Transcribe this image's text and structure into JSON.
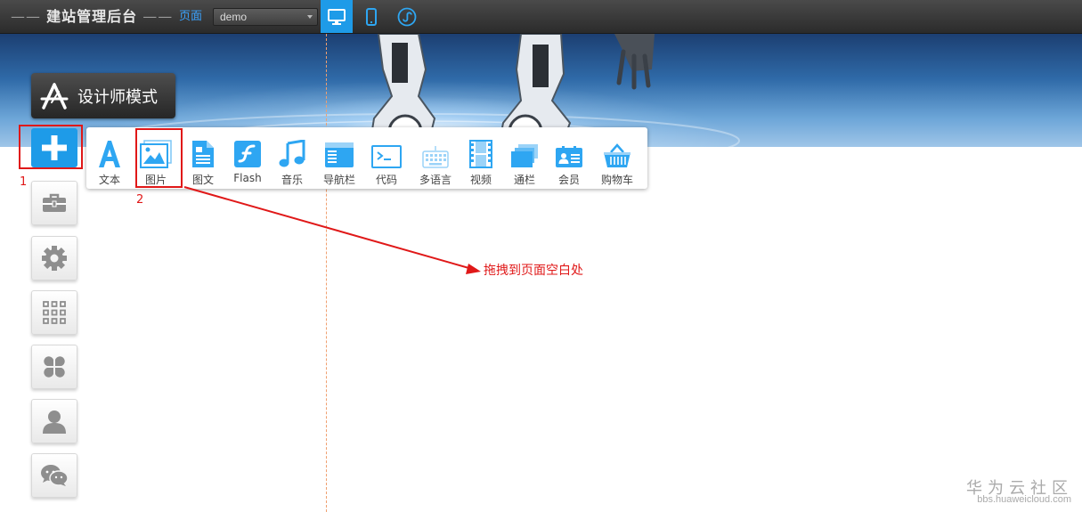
{
  "topbar": {
    "brand_title": "建站管理后台",
    "page_label": "页面",
    "page_select_value": "demo",
    "device_buttons": [
      "desktop-icon",
      "mobile-icon",
      "mini-program-icon"
    ],
    "accent_color": "#1e9be8"
  },
  "designer_mode": {
    "label": "设计师模式"
  },
  "left_dock": {
    "items": [
      "add-icon",
      "toolbox-icon",
      "gear-icon",
      "apps-grid-icon",
      "clover-icon",
      "user-icon",
      "wechat-icon"
    ]
  },
  "widget_panel": {
    "items": [
      {
        "label": "文本",
        "icon": "text-icon"
      },
      {
        "label": "图片",
        "icon": "image-icon"
      },
      {
        "label": "图文",
        "icon": "image-text-icon"
      },
      {
        "label": "Flash",
        "icon": "flash-icon"
      },
      {
        "label": "音乐",
        "icon": "music-icon"
      },
      {
        "label": "导航栏",
        "icon": "navbar-icon"
      },
      {
        "label": "代码",
        "icon": "code-icon"
      },
      {
        "label": "多语言",
        "icon": "keyboard-icon"
      },
      {
        "label": "视频",
        "icon": "video-icon"
      },
      {
        "label": "通栏",
        "icon": "banner-icon"
      },
      {
        "label": "会员",
        "icon": "member-icon"
      },
      {
        "label": "购物车",
        "icon": "cart-icon"
      }
    ]
  },
  "annotations": {
    "step1": "1",
    "step2": "2",
    "drag_hint": "拖拽到页面空白处",
    "annotation_color": "#e01818"
  },
  "watermark": {
    "main": "华为云社区",
    "sub": "bbs.huaweicloud.com"
  }
}
